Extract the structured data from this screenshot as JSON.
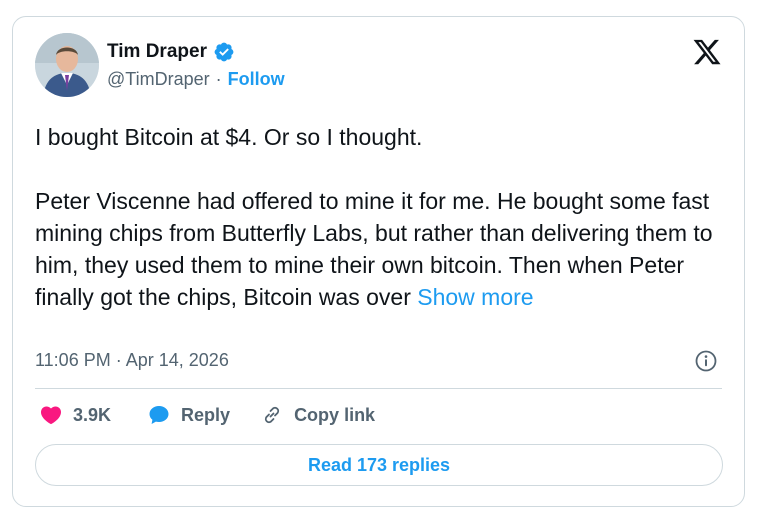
{
  "author": {
    "name": "Tim Draper",
    "handle": "@TimDraper",
    "separator": "·",
    "follow_label": "Follow"
  },
  "tweet": {
    "line1": "I bought Bitcoin at $4. Or so I thought.",
    "paragraph2": "Peter Viscenne had offered to mine it for me. He bought some fast mining chips from Butterfly Labs, but rather than delivering them to him, they used them to mine their own bitcoin. Then when Peter finally got the chips, Bitcoin was over",
    "show_more_label": "Show more"
  },
  "meta": {
    "time": "11:06 PM",
    "separator": "·",
    "date": "Apr 14, 2026"
  },
  "actions": {
    "likes_count": "3.9K",
    "reply_label": "Reply",
    "copy_link_label": "Copy link"
  },
  "read_replies_label": "Read 173 replies",
  "icons": {
    "verified": "verified-badge-icon",
    "x_logo": "x-logo-icon",
    "info": "info-icon",
    "like": "heart-icon",
    "reply": "speech-bubble-icon",
    "copy_link": "link-icon"
  },
  "colors": {
    "accent": "#1d9bf0",
    "like": "#f91880",
    "text_primary": "#0f1419",
    "text_secondary": "#536471",
    "border": "#cfd9de"
  }
}
